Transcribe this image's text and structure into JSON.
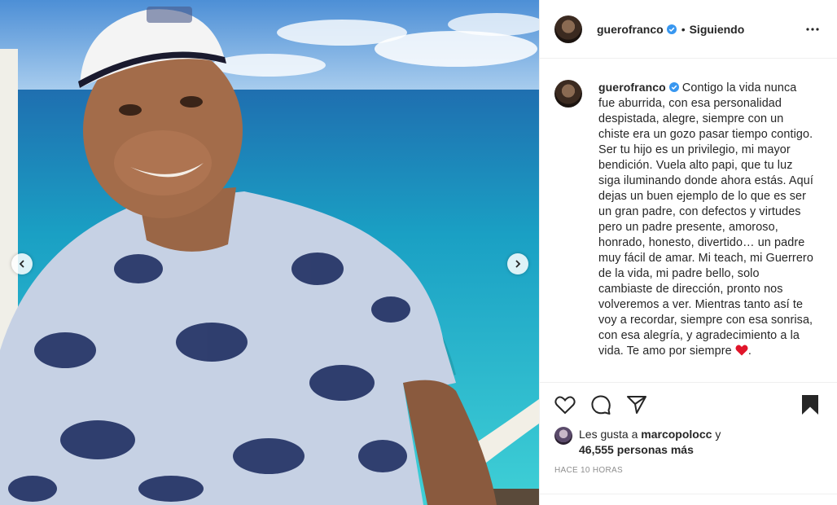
{
  "post": {
    "username": "guerofranco",
    "follow_status": "Siguiendo",
    "separator": "•",
    "caption_author": "guerofranco",
    "caption": "Contigo la vida nunca fue aburrida, con esa personalidad despistada, alegre, siempre con un chiste era un gozo pasar tiempo contigo. Ser tu hijo es un privilegio, mi mayor bendición. Vuela alto papi, que tu luz siga iluminando donde ahora estás. Aquí dejas un buen ejemplo de lo que es ser un gran padre, con defectos y virtudes pero un padre presente, amoroso, honrado, honesto, divertido… un padre muy fácil de amar. Mi teach, mi Guerrero de la vida, mi padre bello, solo cambiaste de dirección, pronto nos volveremos a ver. Mientras tanto así te voy a recordar, siempre con esa sonrisa, con esa alegría, y agradecimiento a la vida. Te amo por siempre",
    "caption_end": ".",
    "likes_prefix": "Les gusta a",
    "likes_user": "marcopolocc",
    "likes_joiner": "y",
    "likes_count": "46,555 personas más",
    "timestamp": "HACE 10 HORAS"
  },
  "icons": {
    "verified": "verified-badge-icon",
    "more": "more-options-icon",
    "like": "heart-outline-icon",
    "comment": "comment-bubble-icon",
    "share": "paper-plane-icon",
    "save": "bookmark-filled-icon",
    "prev": "chevron-left-icon",
    "next": "chevron-right-icon",
    "emoji": "red-heart-emoji-icon"
  },
  "colors": {
    "verified": "#3897f0",
    "heart_emoji": "#e0152a",
    "muted": "#8e8e8e",
    "text": "#262626",
    "sea": "#2cb8c7",
    "sky": "#6fa8dc"
  }
}
